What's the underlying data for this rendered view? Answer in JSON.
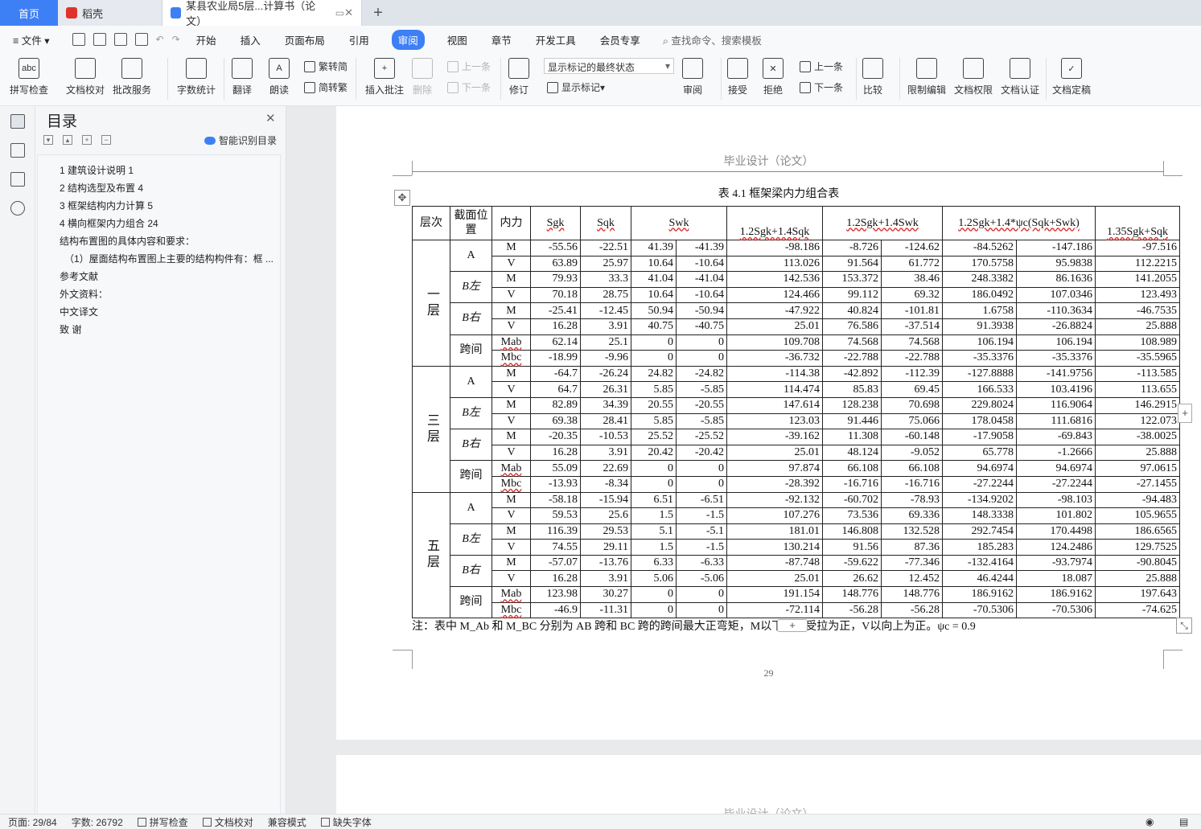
{
  "tabs": {
    "home": "首页",
    "daoke": "稻壳",
    "document": "某县农业局5层...计算书（论文）"
  },
  "menu": {
    "file": "文件",
    "items": [
      "开始",
      "插入",
      "页面布局",
      "引用",
      "审阅",
      "视图",
      "章节",
      "开发工具",
      "会员专享"
    ],
    "active": "审阅",
    "search": "查找命令、搜索模板"
  },
  "ribbon": {
    "spell_check": "拼写检查",
    "doc_proof": "文档校对",
    "batch_service": "批改服务",
    "word_count": "字数统计",
    "translate": "翻译",
    "read_aloud": "朗读",
    "trad_to_simp": "繁转简",
    "simp_to_trad": "简转繁",
    "insert_comment": "插入批注",
    "delete": "删除",
    "prev_comment": "上一条",
    "next_comment": "下一条",
    "track_changes": "修订",
    "markup_state": "显示标记的最终状态",
    "show_markup": "显示标记",
    "review": "审阅",
    "accept": "接受",
    "reject": "拒绝",
    "prev": "上一条",
    "next": "下一条",
    "compare": "比较",
    "restrict_edit": "限制编辑",
    "doc_permission": "文档权限",
    "doc_auth": "文档认证",
    "doc_finalize": "文档定稿"
  },
  "toc": {
    "title": "目录",
    "smart": "智能识别目录",
    "items": [
      "1  建筑设计说明  1",
      "2  结构选型及布置  4",
      "3  框架结构内力计算  5",
      "4  横向框架内力组合  24",
      "结构布置图的具体内容和要求：",
      "（1）屋面结构布置图上主要的结构构件有：框 ...",
      "参考文献",
      "外文资料：",
      "中文译文",
      "致     谢"
    ]
  },
  "page": {
    "header": "毕业设计（论文）",
    "number": "29",
    "next_header": "毕业设计（论文）"
  },
  "table": {
    "caption": "表 4.1 框架梁内力组合表",
    "headers": {
      "layer": "层次",
      "position": "截面位置",
      "force": "内力",
      "sgk": "Sgk",
      "sqk": "Sqk",
      "swk": "Swk",
      "c1": "1.2Sgk+1.4Sqk",
      "c2": "1.2Sgk+1.4Swk",
      "c3": "1.2Sgk+1.4*ψc(Sqk+Swk)",
      "c4": "1.35Sgk+Sqk"
    },
    "layers": [
      {
        "name": "一层",
        "groups": [
          {
            "pos": "A",
            "rows": [
              [
                "M",
                "-55.56",
                "-22.51",
                "41.39",
                "-41.39",
                "-98.186",
                "-8.726",
                "-124.62",
                "-84.5262",
                "-147.186",
                "-97.516"
              ],
              [
                "V",
                "63.89",
                "25.97",
                "10.64",
                "-10.64",
                "113.026",
                "91.564",
                "61.772",
                "170.5758",
                "95.9838",
                "112.2215"
              ]
            ]
          },
          {
            "pos": "B左",
            "rows": [
              [
                "M",
                "79.93",
                "33.3",
                "41.04",
                "-41.04",
                "142.536",
                "153.372",
                "38.46",
                "248.3382",
                "86.1636",
                "141.2055"
              ],
              [
                "V",
                "70.18",
                "28.75",
                "10.64",
                "-10.64",
                "124.466",
                "99.112",
                "69.32",
                "186.0492",
                "107.0346",
                "123.493"
              ]
            ]
          },
          {
            "pos": "B右",
            "rows": [
              [
                "M",
                "-25.41",
                "-12.45",
                "50.94",
                "-50.94",
                "-47.922",
                "40.824",
                "-101.81",
                "1.6758",
                "-110.3634",
                "-46.7535"
              ],
              [
                "V",
                "16.28",
                "3.91",
                "40.75",
                "-40.75",
                "25.01",
                "76.586",
                "-37.514",
                "91.3938",
                "-26.8824",
                "25.888"
              ]
            ]
          },
          {
            "pos": "跨间",
            "rows": [
              [
                "Mab",
                "62.14",
                "25.1",
                "0",
                "0",
                "109.708",
                "74.568",
                "74.568",
                "106.194",
                "106.194",
                "108.989"
              ],
              [
                "Mbc",
                "-18.99",
                "-9.96",
                "0",
                "0",
                "-36.732",
                "-22.788",
                "-22.788",
                "-35.3376",
                "-35.3376",
                "-35.5965"
              ]
            ]
          }
        ]
      },
      {
        "name": "三层",
        "groups": [
          {
            "pos": "A",
            "rows": [
              [
                "M",
                "-64.7",
                "-26.24",
                "24.82",
                "-24.82",
                "-114.38",
                "-42.892",
                "-112.39",
                "-127.8888",
                "-141.9756",
                "-113.585"
              ],
              [
                "V",
                "64.7",
                "26.31",
                "5.85",
                "-5.85",
                "114.474",
                "85.83",
                "69.45",
                "166.533",
                "103.4196",
                "113.655"
              ]
            ]
          },
          {
            "pos": "B左",
            "rows": [
              [
                "M",
                "82.89",
                "34.39",
                "20.55",
                "-20.55",
                "147.614",
                "128.238",
                "70.698",
                "229.8024",
                "116.9064",
                "146.2915"
              ],
              [
                "V",
                "69.38",
                "28.41",
                "5.85",
                "-5.85",
                "123.03",
                "91.446",
                "75.066",
                "178.0458",
                "111.6816",
                "122.073"
              ]
            ]
          },
          {
            "pos": "B右",
            "rows": [
              [
                "M",
                "-20.35",
                "-10.53",
                "25.52",
                "-25.52",
                "-39.162",
                "11.308",
                "-60.148",
                "-17.9058",
                "-69.843",
                "-38.0025"
              ],
              [
                "V",
                "16.28",
                "3.91",
                "20.42",
                "-20.42",
                "25.01",
                "48.124",
                "-9.052",
                "65.778",
                "-1.2666",
                "25.888"
              ]
            ]
          },
          {
            "pos": "跨间",
            "rows": [
              [
                "Mab",
                "55.09",
                "22.69",
                "0",
                "0",
                "97.874",
                "66.108",
                "66.108",
                "94.6974",
                "94.6974",
                "97.0615"
              ],
              [
                "Mbc",
                "-13.93",
                "-8.34",
                "0",
                "0",
                "-28.392",
                "-16.716",
                "-16.716",
                "-27.2244",
                "-27.2244",
                "-27.1455"
              ]
            ]
          }
        ]
      },
      {
        "name": "五层",
        "groups": [
          {
            "pos": "A",
            "rows": [
              [
                "M",
                "-58.18",
                "-15.94",
                "6.51",
                "-6.51",
                "-92.132",
                "-60.702",
                "-78.93",
                "-134.9202",
                "-98.103",
                "-94.483"
              ],
              [
                "V",
                "59.53",
                "25.6",
                "1.5",
                "-1.5",
                "107.276",
                "73.536",
                "69.336",
                "148.3338",
                "101.802",
                "105.9655"
              ]
            ]
          },
          {
            "pos": "B左",
            "rows": [
              [
                "M",
                "116.39",
                "29.53",
                "5.1",
                "-5.1",
                "181.01",
                "146.808",
                "132.528",
                "292.7454",
                "170.4498",
                "186.6565"
              ],
              [
                "V",
                "74.55",
                "29.11",
                "1.5",
                "-1.5",
                "130.214",
                "91.56",
                "87.36",
                "185.283",
                "124.2486",
                "129.7525"
              ]
            ]
          },
          {
            "pos": "B右",
            "rows": [
              [
                "M",
                "-57.07",
                "-13.76",
                "6.33",
                "-6.33",
                "-87.748",
                "-59.622",
                "-77.346",
                "-132.4164",
                "-93.7974",
                "-90.8045"
              ],
              [
                "V",
                "16.28",
                "3.91",
                "5.06",
                "-5.06",
                "25.01",
                "26.62",
                "12.452",
                "46.4244",
                "18.087",
                "25.888"
              ]
            ]
          },
          {
            "pos": "跨间",
            "rows": [
              [
                "Mab",
                "123.98",
                "30.27",
                "0",
                "0",
                "191.154",
                "148.776",
                "148.776",
                "186.9162",
                "186.9162",
                "197.643"
              ],
              [
                "Mbc",
                "-46.9",
                "-11.31",
                "0",
                "0",
                "-72.114",
                "-56.28",
                "-56.28",
                "-70.5306",
                "-70.5306",
                "-74.625"
              ]
            ]
          }
        ]
      }
    ],
    "note": "注：表中 M_Ab 和 M_BC 分别为 AB 跨和 BC 跨的跨间最大正弯矩，M以下部分受拉为正，V以向上为正。ψc = 0.9"
  },
  "status": {
    "page": "页面: 29/84",
    "words": "字数: 26792",
    "spell": "拼写检查",
    "proof": "文档校对",
    "compat": "兼容模式",
    "missing_font": "缺失字体"
  }
}
